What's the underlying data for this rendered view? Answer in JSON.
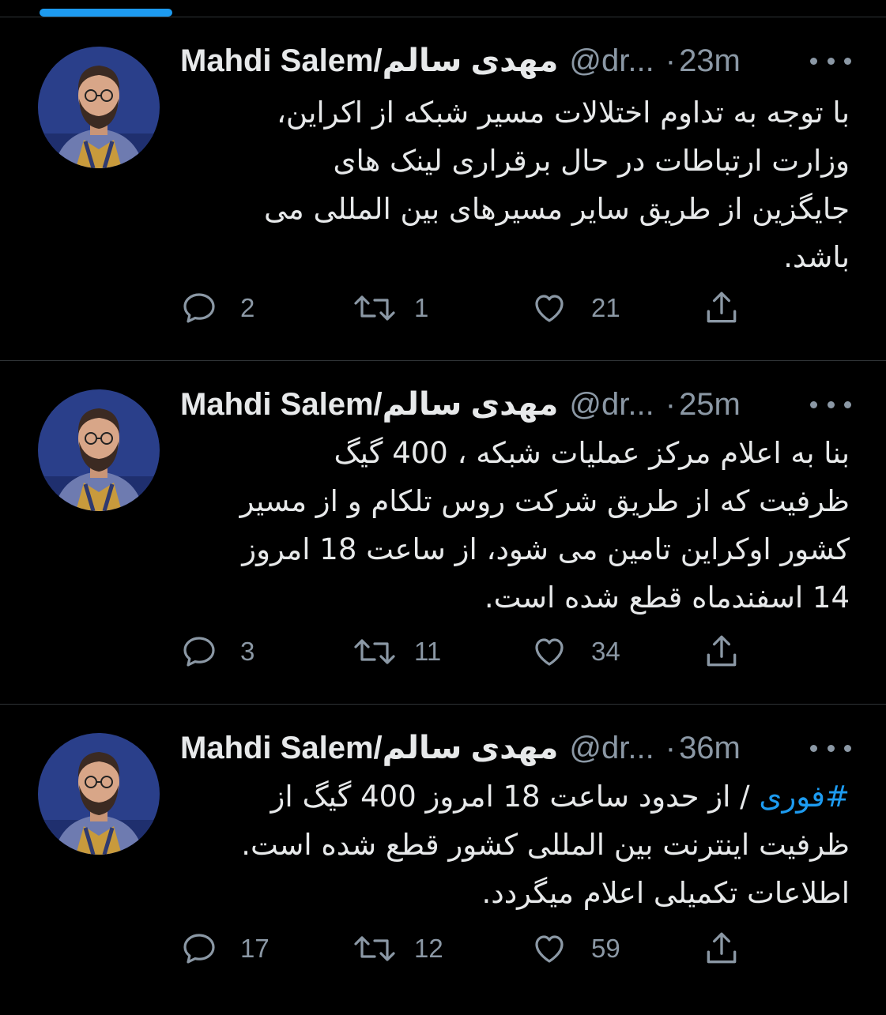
{
  "colors": {
    "background": "#000000",
    "text_primary": "#e7e9ea",
    "text_secondary": "#8b98a5",
    "accent": "#1d9bf0",
    "divider": "#2f3336"
  },
  "tweets": [
    {
      "author": {
        "name": "Mahdi Salem/مهدی سالم",
        "handle": "@dr...",
        "avatar": "profile-photo-bearded-man"
      },
      "separator": "·",
      "time": "23m",
      "body_lines": [
        "با توجه به تداوم اختلالات مسیر شبکه از اکراین،",
        "وزارت ارتباطات در حال برقراری لینک های",
        "جایگزین از طریق سایر مسیرهای بین المللی می",
        "باشد."
      ],
      "replies": "2",
      "retweets": "1",
      "likes": "21"
    },
    {
      "author": {
        "name": "Mahdi Salem/مهدی سالم",
        "handle": "@dr...",
        "avatar": "profile-photo-bearded-man"
      },
      "separator": "·",
      "time": "25m",
      "body_lines": [
        "بنا به اعلام مرکز عملیات شبکه ، 400 گیگ",
        "ظرفیت که از طریق شرکت روس تلکام و از مسیر",
        "کشور اوکراین تامین می شود، از ساعت 18 امروز",
        "14 اسفندماه قطع شده است."
      ],
      "replies": "3",
      "retweets": "11",
      "likes": "34"
    },
    {
      "author": {
        "name": "Mahdi Salem/مهدی سالم",
        "handle": "@dr...",
        "avatar": "profile-photo-bearded-man"
      },
      "separator": "·",
      "time": "36m",
      "hashtag": "#فوری",
      "body_first_line_rest": " / از حدود ساعت 18 امروز 400 گیگ از",
      "body_lines": [
        "ظرفیت اینترنت بین المللی کشور قطع شده است.",
        "اطلاعات تکمیلی اعلام میگردد."
      ],
      "replies": "17",
      "retweets": "12",
      "likes": "59"
    }
  ]
}
